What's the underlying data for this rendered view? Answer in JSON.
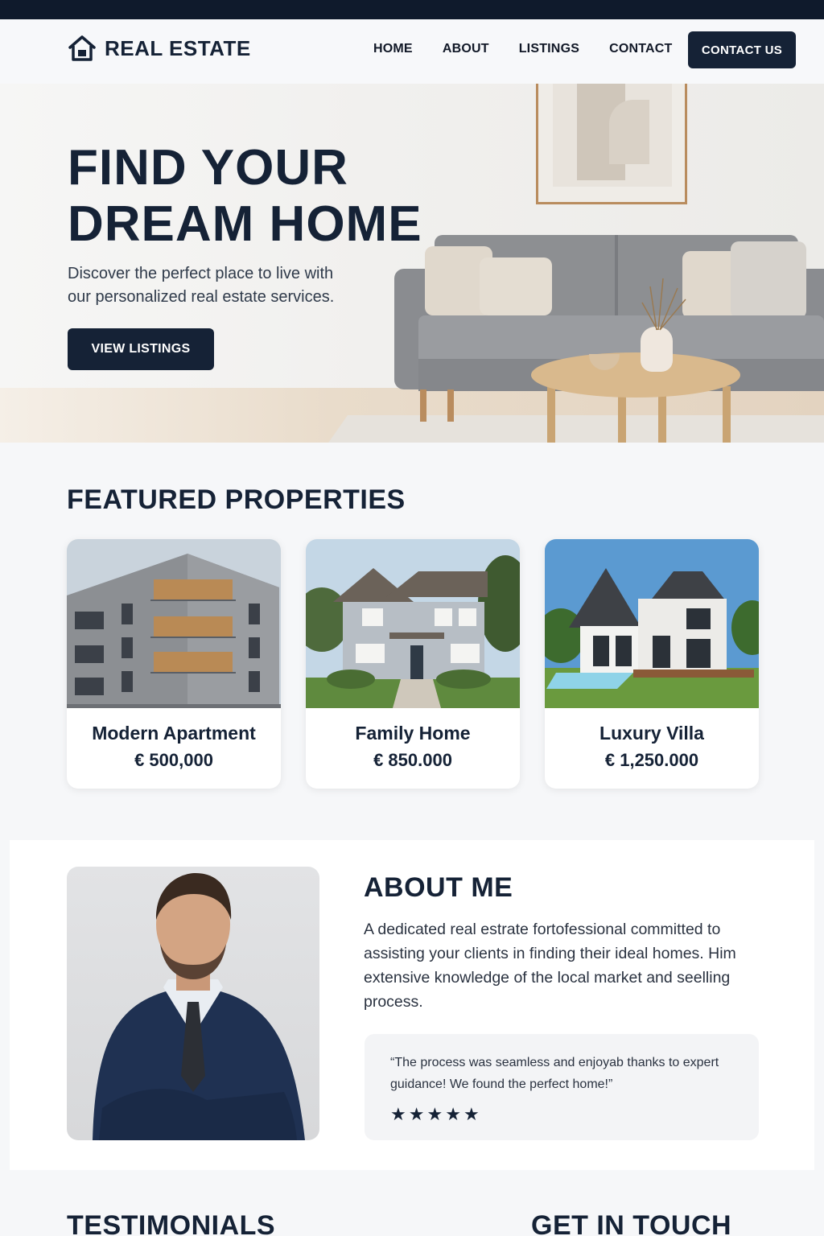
{
  "header": {
    "brand": "REAL ESTATE",
    "nav": [
      "HOME",
      "ABOUT",
      "LISTINGS",
      "CONTACT"
    ],
    "cta_label": "CONTACT US"
  },
  "hero": {
    "title_line1": "FIND YOUR",
    "title_line2": "DREAM HOME",
    "subtitle": "Discover the perfect place to live with our personalized real estate services.",
    "button_label": "VIEW LISTINGS"
  },
  "featured": {
    "title": "FEATURED PROPERTIES",
    "cards": [
      {
        "name": "Modern Apartment",
        "price": "€ 500,000"
      },
      {
        "name": "Family Home",
        "price": "€ 850.000"
      },
      {
        "name": "Luxury Villa",
        "price": "€ 1,250.000"
      }
    ]
  },
  "about": {
    "title": "ABOUT ME",
    "text": "A dedicated real estrate fortofessional committed to assisting your clients in finding their ideal homes. Him extensive knowledge of the local market and seelling process.",
    "quote": "“The process was seamless and enjoyab thanks to expert guidance! We found the perfect home!”",
    "rating": 5
  },
  "bottom": {
    "testimonials_title": "TESTIMONIALS",
    "contact_title": "GET IN TOUCH"
  },
  "colors": {
    "primary": "#152236",
    "topbar": "#0f1a2c",
    "background": "#f6f7f9"
  }
}
